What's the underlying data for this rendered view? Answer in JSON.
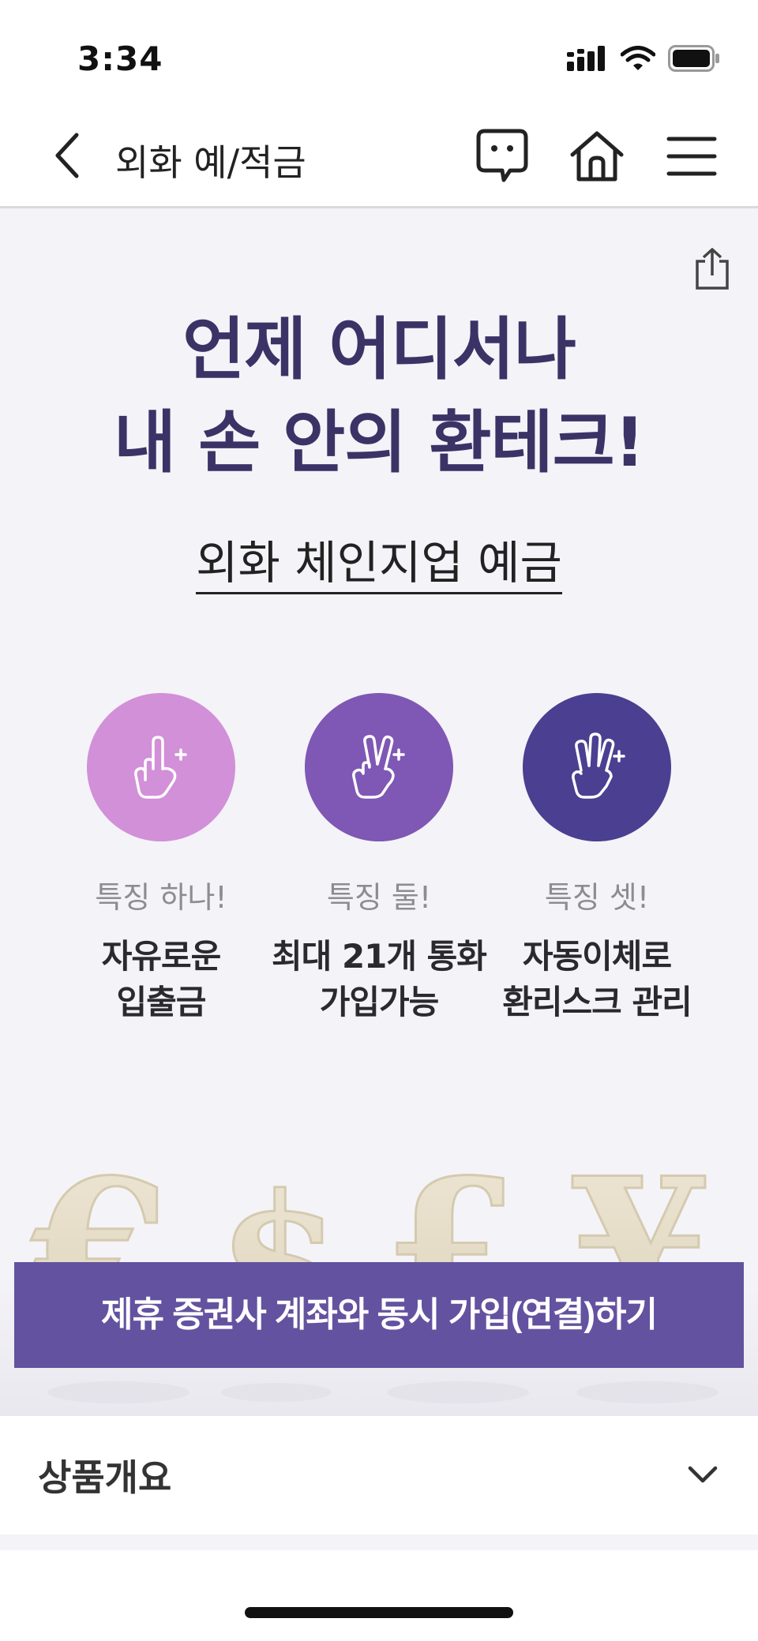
{
  "status_bar": {
    "time": "3:34"
  },
  "nav": {
    "title": "외화 예/적금",
    "icons": [
      "chevron-left-icon",
      "chat-icon",
      "home-icon",
      "menu-icon"
    ]
  },
  "hero": {
    "headline_line1": "언제 어디서나",
    "headline_line2": "내 손 안의 환테크!",
    "product_name": "외화 체인지업 예금",
    "features": [
      {
        "label": "특징 하나!",
        "desc_line1": "자유로운",
        "desc_line2": "입출금",
        "color": "#d190d8",
        "icon": "one-finger-hand-icon"
      },
      {
        "label": "특징 둘!",
        "desc_line1": "최대 21개 통화",
        "desc_line2": "가입가능",
        "color": "#7f57b4",
        "icon": "two-finger-hand-icon"
      },
      {
        "label": "특징 셋!",
        "desc_line1": "자동이체로",
        "desc_line2": "환리스크 관리",
        "color": "#4b3f91",
        "icon": "three-finger-hand-icon"
      }
    ],
    "cta_label": "제휴 증권사 계좌와 동시 가입(연결)하기"
  },
  "accordion": {
    "title": "상품개요"
  },
  "colors": {
    "headline": "#3b3366",
    "cta": "#63529f",
    "hero_bg": "#f4f3f8"
  }
}
